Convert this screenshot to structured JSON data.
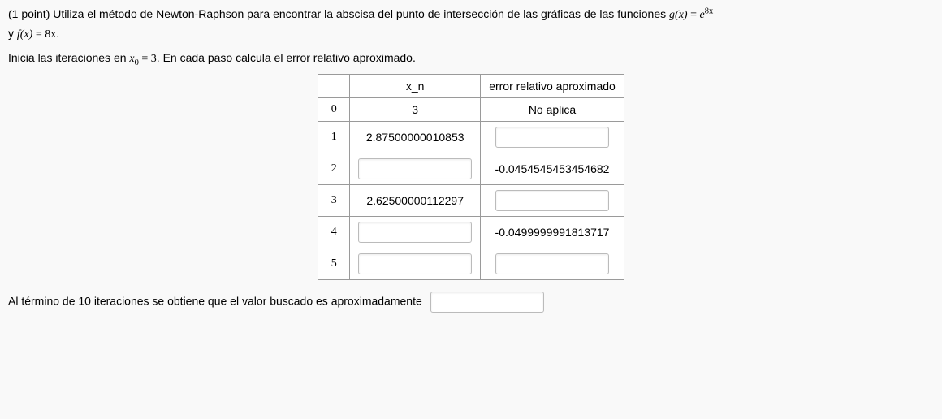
{
  "problem": {
    "points_prefix": "(1 point) ",
    "intro_before_g": "Utiliza el método de Newton-Raphson para encontrar la abscisa del punto de intersección de las gráficas de las funciones ",
    "g_lhs": "g(x)",
    "equals": " = ",
    "g_rhs_base": "e",
    "g_rhs_exp": "8x",
    "conj_y": "y ",
    "f_lhs": "f(x)",
    "f_rhs": "8x",
    "period": "."
  },
  "instruction": {
    "before_x0": "Inicia las iteraciones en ",
    "x0_sym": "x",
    "x0_sub": "0",
    "x0_val": "3",
    "after_x0": ". En cada paso calcula el error relativo aproximado."
  },
  "table": {
    "header_xn": "x_n",
    "header_err": "error relativo aproximado",
    "rows": [
      {
        "n": "0",
        "xn": "3",
        "err": "No aplica",
        "xn_input": false,
        "err_input": false
      },
      {
        "n": "1",
        "xn": "2.87500000010853",
        "err": "",
        "xn_input": false,
        "err_input": true
      },
      {
        "n": "2",
        "xn": "",
        "err": "-0.0454545453454682",
        "xn_input": true,
        "err_input": false
      },
      {
        "n": "3",
        "xn": "2.62500000112297",
        "err": "",
        "xn_input": false,
        "err_input": true
      },
      {
        "n": "4",
        "xn": "",
        "err": "-0.0499999991813717",
        "xn_input": true,
        "err_input": false
      },
      {
        "n": "5",
        "xn": "",
        "err": "",
        "xn_input": true,
        "err_input": true
      }
    ]
  },
  "final": {
    "text": "Al término de 10 iteraciones se obtiene que el valor buscado es aproximadamente"
  }
}
